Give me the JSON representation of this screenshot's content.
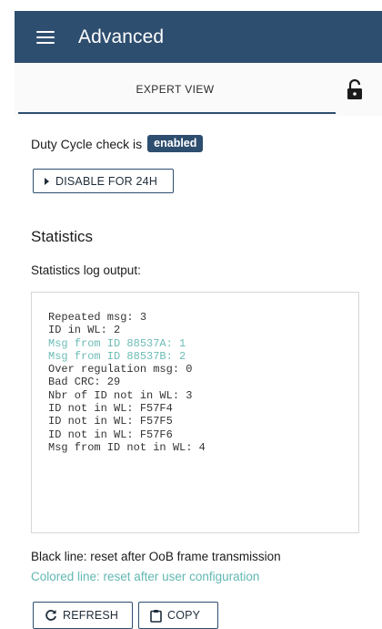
{
  "header": {
    "title": "Advanced",
    "menu_icon": "hamburger-menu-icon"
  },
  "tabs": {
    "active_label": "EXPERT VIEW",
    "lock_icon": "lock-open-icon"
  },
  "duty_cycle": {
    "label": "Duty Cycle check is",
    "status": "enabled",
    "disable_button": "DISABLE FOR 24H"
  },
  "statistics": {
    "title": "Statistics",
    "subtitle": "Statistics log output:",
    "log_lines": [
      {
        "text": "Repeated msg: 3",
        "colored": false
      },
      {
        "text": "ID in WL: 2",
        "colored": false
      },
      {
        "text": "Msg from ID 88537A: 1",
        "colored": true
      },
      {
        "text": "Msg from ID 88537B: 2",
        "colored": true
      },
      {
        "text": "Over regulation msg: 0",
        "colored": false
      },
      {
        "text": "Bad CRC: 29",
        "colored": false
      },
      {
        "text": "Nbr of ID not in WL: 3",
        "colored": false
      },
      {
        "text": "ID not in WL: F57F4",
        "colored": false
      },
      {
        "text": "ID not in WL: F57F5",
        "colored": false
      },
      {
        "text": "ID not in WL: F57F6",
        "colored": false
      },
      {
        "text": "Msg from ID not in WL: 4",
        "colored": false
      }
    ],
    "legend_black": "Black line: reset after OoB frame transmission",
    "legend_colored": "Colored line: reset after user configuration"
  },
  "actions": {
    "refresh_label": "REFRESH",
    "copy_label": "COPY"
  },
  "colors": {
    "primary": "#2e4e6f",
    "colored_line": "#6cbcb6"
  }
}
